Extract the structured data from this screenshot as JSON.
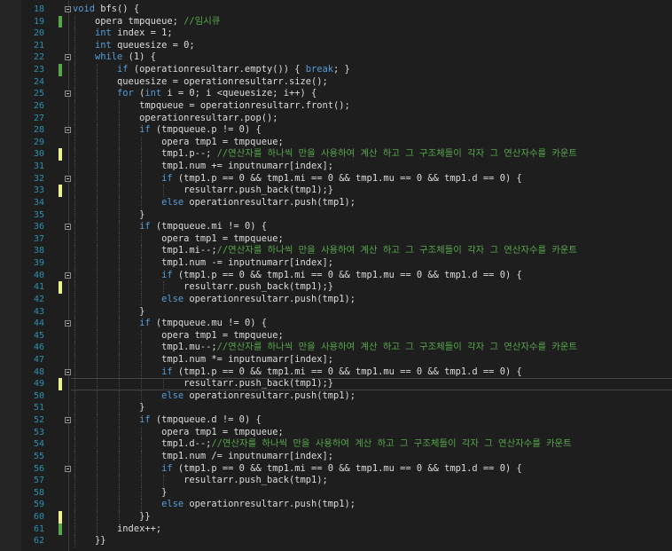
{
  "editor": {
    "current_line": 49,
    "lines": [
      {
        "num": "18",
        "text": "void bfs() {",
        "mark": "",
        "fold": true
      },
      {
        "num": "19",
        "text": "    opera tmpqueue; //임시큐",
        "mark": "g",
        "fold": false
      },
      {
        "num": "20",
        "text": "    int index = 1;",
        "mark": "",
        "fold": false
      },
      {
        "num": "21",
        "text": "    int queuesize = 0;",
        "mark": "",
        "fold": false
      },
      {
        "num": "22",
        "text": "    while (1) {",
        "mark": "",
        "fold": true
      },
      {
        "num": "23",
        "text": "        if (operationresultarr.empty()) { break; }",
        "mark": "g",
        "fold": false
      },
      {
        "num": "24",
        "text": "        queuesize = operationresultarr.size();",
        "mark": "",
        "fold": false
      },
      {
        "num": "25",
        "text": "        for (int i = 0; i <queuesize; i++) {",
        "mark": "",
        "fold": true
      },
      {
        "num": "26",
        "text": "            tmpqueue = operationresultarr.front();",
        "mark": "",
        "fold": false
      },
      {
        "num": "27",
        "text": "            operationresultarr.pop();",
        "mark": "",
        "fold": false
      },
      {
        "num": "28",
        "text": "            if (tmpqueue.p != 0) {",
        "mark": "",
        "fold": true
      },
      {
        "num": "29",
        "text": "                opera tmp1 = tmpqueue;",
        "mark": "",
        "fold": false
      },
      {
        "num": "30",
        "text": "                tmp1.p--; //연산자를 하나씩 만을 사용하여 계산 하고 그 구조체들이 각자 그 연산자수를 카운트",
        "mark": "y",
        "fold": false
      },
      {
        "num": "31",
        "text": "                tmp1.num += inputnumarr[index];",
        "mark": "",
        "fold": false
      },
      {
        "num": "32",
        "text": "                if (tmp1.p == 0 && tmp1.mi == 0 && tmp1.mu == 0 && tmp1.d == 0) {",
        "mark": "",
        "fold": true
      },
      {
        "num": "33",
        "text": "                    resultarr.push_back(tmp1);}",
        "mark": "y",
        "fold": false
      },
      {
        "num": "34",
        "text": "                else operationresultarr.push(tmp1);",
        "mark": "",
        "fold": false
      },
      {
        "num": "35",
        "text": "            }",
        "mark": "",
        "fold": false
      },
      {
        "num": "36",
        "text": "            if (tmpqueue.mi != 0) {",
        "mark": "",
        "fold": true
      },
      {
        "num": "37",
        "text": "                opera tmp1 = tmpqueue;",
        "mark": "",
        "fold": false
      },
      {
        "num": "38",
        "text": "                tmp1.mi--;//연산자를 하나씩 만을 사용하여 계산 하고 그 구조체들이 각자 그 연산자수를 카운트",
        "mark": "",
        "fold": false
      },
      {
        "num": "39",
        "text": "                tmp1.num -= inputnumarr[index];",
        "mark": "",
        "fold": false
      },
      {
        "num": "40",
        "text": "                if (tmp1.p == 0 && tmp1.mi == 0 && tmp1.mu == 0 && tmp1.d == 0) {",
        "mark": "",
        "fold": true
      },
      {
        "num": "41",
        "text": "                    resultarr.push_back(tmp1);}",
        "mark": "y",
        "fold": false
      },
      {
        "num": "42",
        "text": "                else operationresultarr.push(tmp1);",
        "mark": "",
        "fold": false
      },
      {
        "num": "43",
        "text": "            }",
        "mark": "",
        "fold": false
      },
      {
        "num": "44",
        "text": "            if (tmpqueue.mu != 0) {",
        "mark": "",
        "fold": true
      },
      {
        "num": "45",
        "text": "                opera tmp1 = tmpqueue;",
        "mark": "",
        "fold": false
      },
      {
        "num": "46",
        "text": "                tmp1.mu--;//연산자를 하나씩 만을 사용하여 계산 하고 그 구조체들이 각자 그 연산자수를 카운트",
        "mark": "",
        "fold": false
      },
      {
        "num": "47",
        "text": "                tmp1.num *= inputnumarr[index];",
        "mark": "",
        "fold": false
      },
      {
        "num": "48",
        "text": "                if (tmp1.p == 0 && tmp1.mi == 0 && tmp1.mu == 0 && tmp1.d == 0) {",
        "mark": "",
        "fold": true
      },
      {
        "num": "49",
        "text": "                    resultarr.push_back(tmp1);}",
        "mark": "y",
        "fold": false
      },
      {
        "num": "50",
        "text": "                else operationresultarr.push(tmp1);",
        "mark": "",
        "fold": false
      },
      {
        "num": "51",
        "text": "            }",
        "mark": "",
        "fold": false
      },
      {
        "num": "52",
        "text": "            if (tmpqueue.d != 0) {",
        "mark": "",
        "fold": true
      },
      {
        "num": "53",
        "text": "                opera tmp1 = tmpqueue;",
        "mark": "",
        "fold": false
      },
      {
        "num": "54",
        "text": "                tmp1.d--;//연산자를 하나씩 만을 사용하여 계산 하고 그 구조체들이 각자 그 연산자수를 카운트",
        "mark": "",
        "fold": false
      },
      {
        "num": "55",
        "text": "                tmp1.num /= inputnumarr[index];",
        "mark": "",
        "fold": false
      },
      {
        "num": "56",
        "text": "                if (tmp1.p == 0 && tmp1.mi == 0 && tmp1.mu == 0 && tmp1.d == 0) {",
        "mark": "",
        "fold": true
      },
      {
        "num": "57",
        "text": "                    resultarr.push_back(tmp1);",
        "mark": "",
        "fold": false
      },
      {
        "num": "58",
        "text": "                }",
        "mark": "",
        "fold": false
      },
      {
        "num": "59",
        "text": "                else operationresultarr.push(tmp1);",
        "mark": "",
        "fold": false
      },
      {
        "num": "60",
        "text": "            }}",
        "mark": "y",
        "fold": false
      },
      {
        "num": "61",
        "text": "        index++;",
        "mark": "g",
        "fold": false
      },
      {
        "num": "62",
        "text": "    }}",
        "mark": "",
        "fold": false
      }
    ],
    "colors": {
      "background": "#1e1e1e",
      "keyword": "#569cd6",
      "comment": "#57a64a",
      "line_number": "#2b91af",
      "text": "#dcdcdc"
    }
  }
}
